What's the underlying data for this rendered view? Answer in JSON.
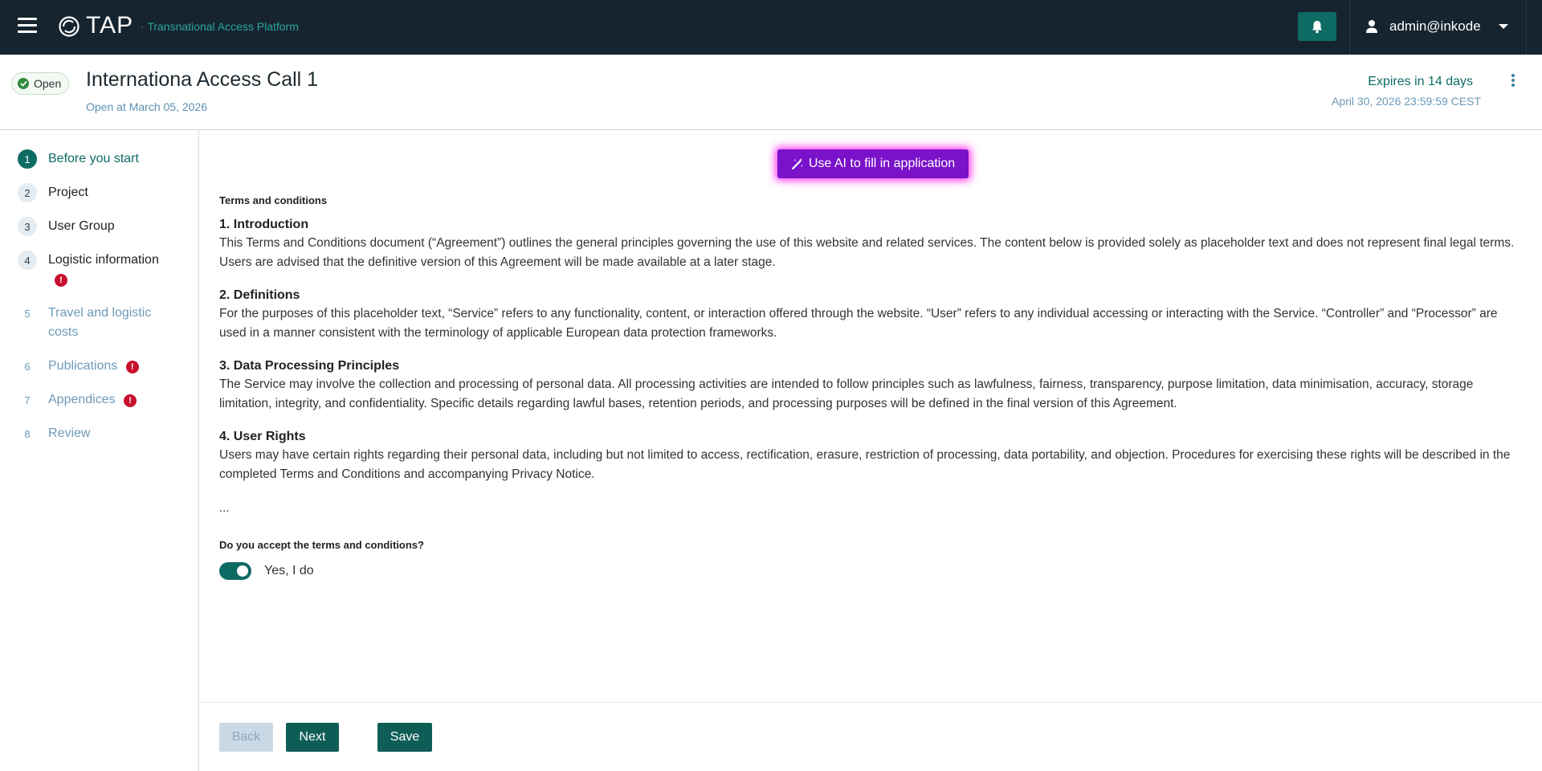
{
  "topbar": {
    "logo_text": "TAP",
    "logo_subtitle": "Transnational Access Platform",
    "user_name": "admin@inkode"
  },
  "call": {
    "status": "Open",
    "title": "Internationa Access Call 1",
    "opened": "Open at March 05, 2026",
    "expires": "Expires in 14 days",
    "deadline": "April 30, 2026 23:59:59 CEST"
  },
  "steps": [
    {
      "num": "1",
      "label": "Before you start"
    },
    {
      "num": "2",
      "label": "Project"
    },
    {
      "num": "3",
      "label": "User Group"
    },
    {
      "num": "4",
      "label": "Logistic information"
    },
    {
      "num": "5",
      "label": "Travel and logistic costs"
    },
    {
      "num": "6",
      "label": "Publications"
    },
    {
      "num": "7",
      "label": "Appendices"
    },
    {
      "num": "8",
      "label": "Review"
    }
  ],
  "ai_button": "Use AI to fill in application",
  "terms": {
    "title": "Terms and conditions",
    "sections": [
      {
        "heading": "1. Introduction",
        "body": "This Terms and Conditions document (“Agreement”) outlines the general principles governing the use of this website and related services. The content below is provided solely as placeholder text and does not represent final legal terms. Users are advised that the definitive version of this Agreement will be made available at a later stage."
      },
      {
        "heading": "2. Definitions",
        "body": "For the purposes of this placeholder text, “Service” refers to any functionality, content, or interaction offered through the website. “User” refers to any individual accessing or interacting with the Service. “Controller” and “Processor” are used in a manner consistent with the terminology of applicable European data protection frameworks."
      },
      {
        "heading": "3. Data Processing Principles",
        "body": "The Service may involve the collection and processing of personal data. All processing activities are intended to follow principles such as lawfulness, fairness, transparency, purpose limitation, data minimisation, accuracy, storage limitation, integrity, and confidentiality. Specific details regarding lawful bases, retention periods, and processing purposes will be defined in the final version of this Agreement."
      },
      {
        "heading": "4. User Rights",
        "body": "Users may have certain rights regarding their personal data, including but not limited to access, rectification, erasure, restriction of processing, data portability, and objection. Procedures for exercising these rights will be described in the completed Terms and Conditions and accompanying Privacy Notice."
      }
    ],
    "ellipsis": "...",
    "question": "Do you accept the terms and conditions?",
    "accept_label": "Yes, I do"
  },
  "footer": {
    "back": "Back",
    "next": "Next",
    "save": "Save"
  },
  "colors": {
    "topbar": "#16242f",
    "accent": "#0e6b64",
    "ai": "#7a12c9",
    "warning": "#c8102e"
  }
}
